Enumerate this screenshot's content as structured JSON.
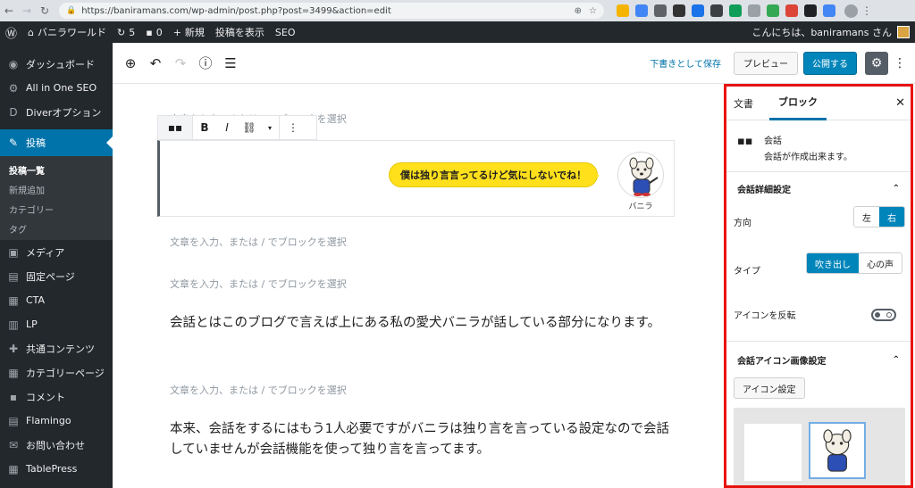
{
  "browser": {
    "url": "https://baniramans.com/wp-admin/post.php?post=3499&action=edit"
  },
  "adminbar": {
    "site_name": "バニラワールド",
    "updates": "5",
    "comments": "0",
    "new": "新規",
    "view_post": "投稿を表示",
    "seo": "SEO",
    "greeting": "こんにちは、baniramans さん"
  },
  "sidebar": {
    "items": [
      {
        "label": "ダッシュボード",
        "icon": "dashboard-icon"
      },
      {
        "label": "All in One SEO",
        "icon": "seo-icon"
      },
      {
        "label": "Diverオプション",
        "icon": "diver-icon"
      },
      {
        "label": "投稿",
        "icon": "pin-icon"
      },
      {
        "label": "メディア",
        "icon": "media-icon"
      },
      {
        "label": "固定ページ",
        "icon": "page-icon"
      },
      {
        "label": "CTA",
        "icon": "cta-icon"
      },
      {
        "label": "LP",
        "icon": "lp-icon"
      },
      {
        "label": "共通コンテンツ",
        "icon": "common-icon"
      },
      {
        "label": "カテゴリーページ",
        "icon": "category-icon"
      },
      {
        "label": "コメント",
        "icon": "comment-icon"
      },
      {
        "label": "Flamingo",
        "icon": "flamingo-icon"
      },
      {
        "label": "お問い合わせ",
        "icon": "mail-icon"
      },
      {
        "label": "TablePress",
        "icon": "table-icon"
      }
    ],
    "submenu": [
      "投稿一覧",
      "新規追加",
      "カテゴリー",
      "タグ"
    ]
  },
  "toolbar": {
    "save_draft": "下書きとして保存",
    "preview": "プレビュー",
    "publish": "公開する"
  },
  "editor": {
    "placeholder": "文章を入力、または / でブロックを選択",
    "bubble_text": "僕は独り言言ってるけど気にしないでね！",
    "speaker_name": "バニラ",
    "para1": "会話とはこのブログで言えば上にある私の愛犬バニラが話している部分になります。",
    "para2": "本来、会話をするにはもう1人必要ですがバニラは独り言を言っている設定なので会話していませんが会話機能を使って独り言を言ってます。"
  },
  "panel": {
    "tab_doc": "文書",
    "tab_block": "ブロック",
    "block_name": "会話",
    "block_desc": "会話が作成出来ます。",
    "section_detail": "会話詳細設定",
    "direction_label": "方向",
    "direction_left": "左",
    "direction_right": "右",
    "type_label": "タイプ",
    "type_bubble": "吹き出し",
    "type_thought": "心の声",
    "flip_label": "アイコンを反転",
    "section_icon": "会話アイコン画像設定",
    "icon_button": "アイコン設定"
  },
  "colors": {
    "accent": "#0085ba",
    "highlight_border": "#e8120d",
    "bubble": "#ffe01b"
  }
}
